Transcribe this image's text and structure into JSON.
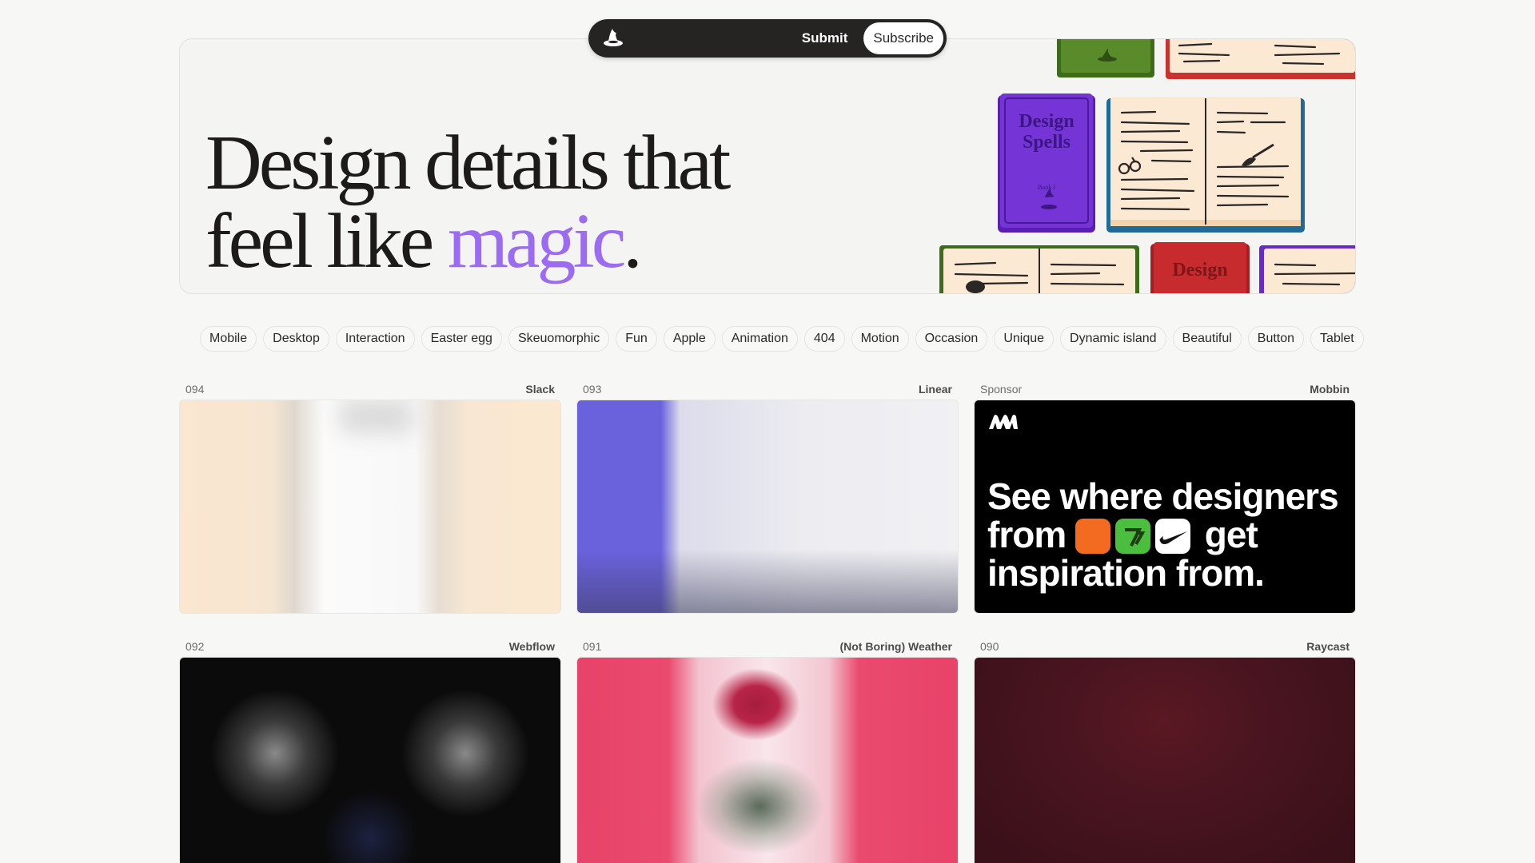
{
  "nav": {
    "submit_label": "Submit",
    "subscribe_label": "Subscribe"
  },
  "hero": {
    "title_line1": "Design details that",
    "title_line2_prefix": "feel like ",
    "title_line2_accent": "magic",
    "title_line2_suffix": ".",
    "accent_color": "#9b6bf2",
    "book_title_1": "Design",
    "book_title_2": "Spells",
    "book_subtitle": "Book I",
    "red_book_title": "Design"
  },
  "tags": [
    "Mobile",
    "Desktop",
    "Interaction",
    "Easter egg",
    "Skeuomorphic",
    "Fun",
    "Apple",
    "Animation",
    "404",
    "Motion",
    "Occasion",
    "Unique",
    "Dynamic island",
    "Beautiful",
    "Button",
    "Tablet"
  ],
  "cards": [
    {
      "num": "094",
      "brand": "Slack"
    },
    {
      "num": "093",
      "brand": "Linear"
    },
    {
      "num": "Sponsor",
      "brand": "Mobbin"
    },
    {
      "num": "092",
      "brand": "Webflow"
    },
    {
      "num": "091",
      "brand": "(Not Boring) Weather"
    },
    {
      "num": "090",
      "brand": "Raycast"
    }
  ],
  "sponsor": {
    "line1": "See where designers",
    "line2_prefix": "from",
    "line2_suffix": "get",
    "line3": "inspiration from."
  }
}
